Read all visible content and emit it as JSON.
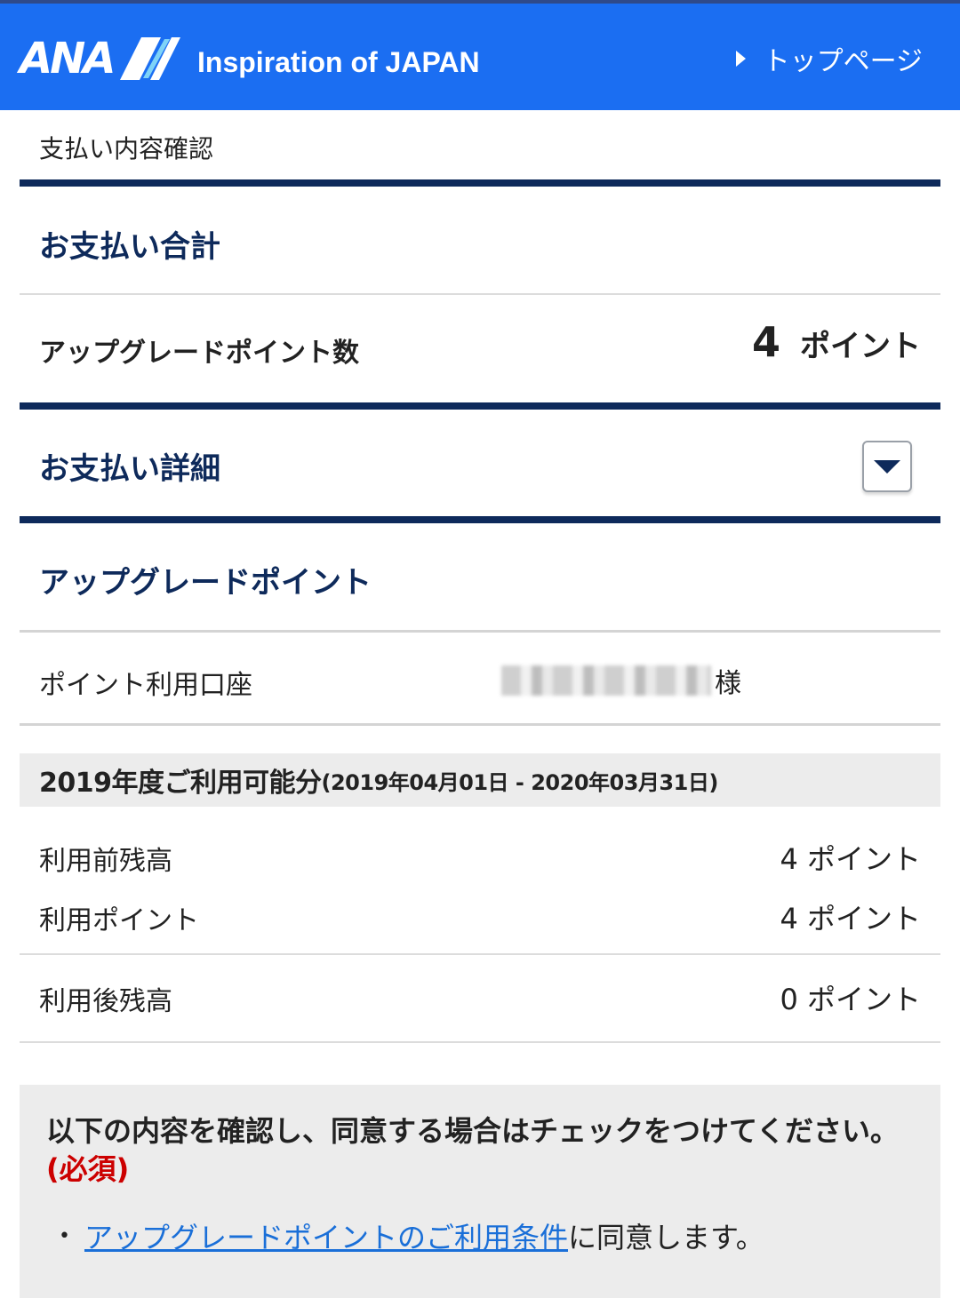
{
  "header": {
    "logo": "ANA",
    "tagline": "Inspiration of JAPAN",
    "top_link": "トップページ"
  },
  "breadcrumb": "支払い内容確認",
  "payment_total": {
    "title": "お支払い合計",
    "label": "アップグレードポイント数",
    "value": "4",
    "unit": "ポイント"
  },
  "payment_detail": {
    "title": "お支払い詳細"
  },
  "upgrade_points": {
    "title": "アップグレードポイント",
    "account_label": "ポイント利用口座",
    "account_suffix": "様",
    "period_title": "2019年度ご利用可能分",
    "period_range": "(2019年04月01日 - 2020年03月31日)",
    "rows": [
      {
        "label": "利用前残高",
        "value": "4 ポイント"
      },
      {
        "label": "利用ポイント",
        "value": "4 ポイント"
      },
      {
        "label": "利用後残高",
        "value": "0 ポイント"
      }
    ]
  },
  "agreement": {
    "text": "以下の内容を確認し、同意する場合はチェックをつけてください。",
    "required": "(必須)",
    "link": "アップグレードポイントのご利用条件",
    "link_suffix": "に同意します。"
  },
  "colors": {
    "header_bg": "#1b6ef2",
    "navy": "#0e2a5b",
    "link": "#1a6fd8",
    "required": "#cc0000"
  }
}
